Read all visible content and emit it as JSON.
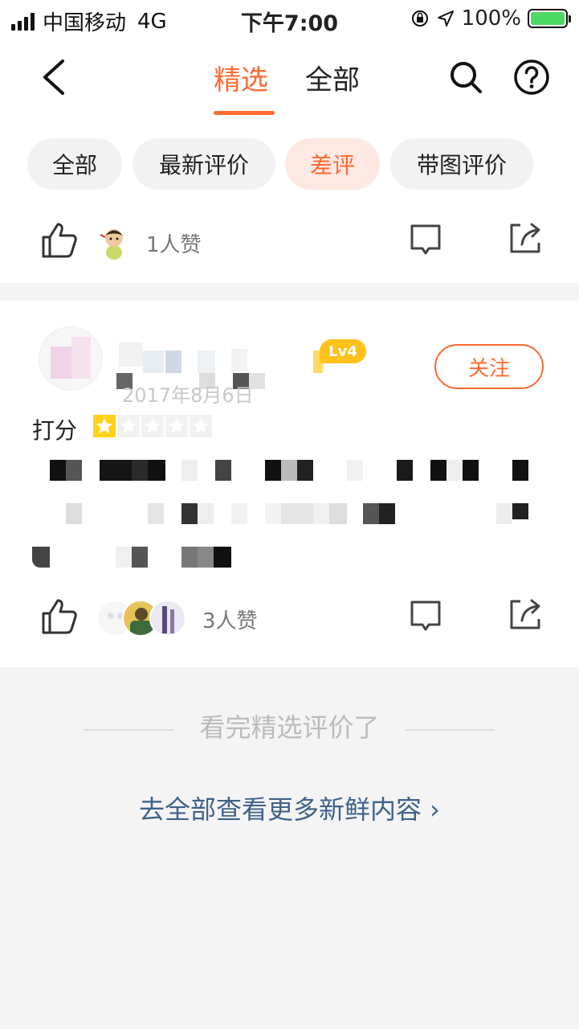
{
  "status_bar": {
    "carrier": "中国移动",
    "network": "4G",
    "time": "下午7:00",
    "battery": "100%"
  },
  "nav": {
    "tabs": [
      {
        "label": "精选",
        "active": true
      },
      {
        "label": "全部",
        "active": false
      }
    ]
  },
  "filters": [
    {
      "label": "全部",
      "active": false
    },
    {
      "label": "最新评价",
      "active": false
    },
    {
      "label": "差评",
      "active": true
    },
    {
      "label": "带图评价",
      "active": false
    }
  ],
  "first_post_actions": {
    "likes_text": "1人赞"
  },
  "review": {
    "date": "2017年8月6日",
    "level": "Lv4",
    "follow_label": "关注",
    "rating_label": "打分",
    "rating": 1,
    "rating_max": 5,
    "likes_text": "3人赞"
  },
  "footer": {
    "finished_text": "看完精选评价了",
    "more_link": "去全部查看更多新鲜内容 ›"
  },
  "colors": {
    "accent": "#ff6a33",
    "link": "#3f6289",
    "level_badge": "#ffc21a",
    "star": "#ffd11a"
  }
}
